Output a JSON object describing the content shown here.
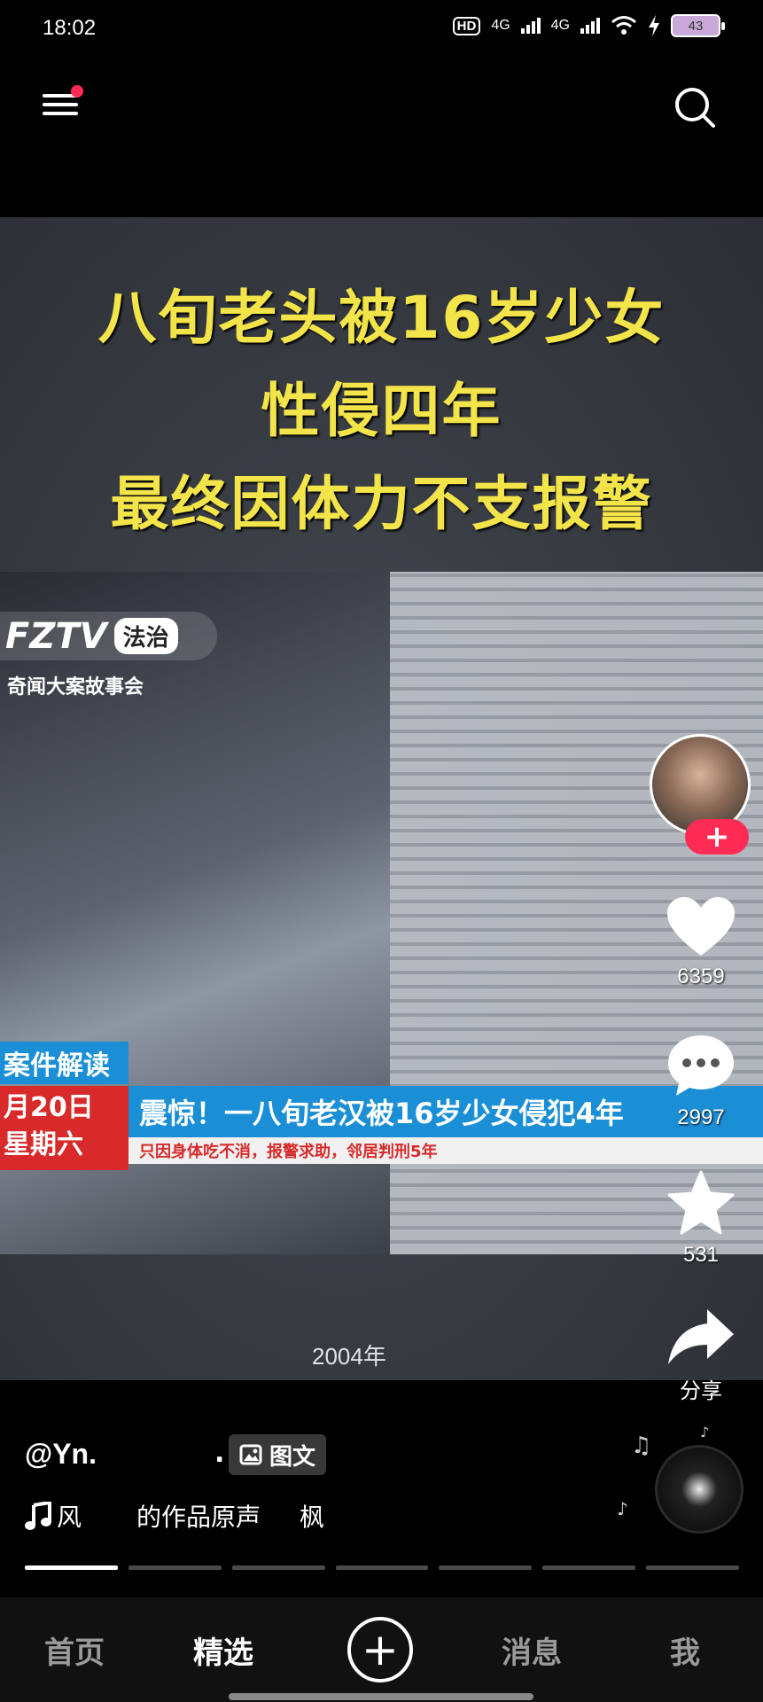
{
  "status_bar": {
    "time": "18:02",
    "hd": "HD",
    "network1": "4G",
    "network2": "4G",
    "battery": "43"
  },
  "video": {
    "caption_lines": [
      "八旬老头被16岁少女",
      "性侵四年",
      "最终因体力不支报警"
    ],
    "logo_main": "FZTV",
    "logo_tag": "法治",
    "logo_sub": "奇闻大案故事会",
    "year_label": "2004年",
    "lower_third": {
      "section": "案件解读",
      "date": "月20日",
      "weekday": "星期六",
      "headline": "震惊！一八旬老汉被16岁少女侵犯4年",
      "subline": "只因身体吃不消，报警求助，邻居判刑5年"
    }
  },
  "side_actions": {
    "follow": "+",
    "likes": "6359",
    "comments": "2997",
    "favorites": "531",
    "share": "分享"
  },
  "post": {
    "author": "@Yn.",
    "author_dot": ".",
    "type_badge": "图文",
    "music_a": "风",
    "music_b": "的作品原声",
    "music_c": "枫"
  },
  "progress": {
    "segments": 7,
    "active_index": 0
  },
  "bottom_nav": {
    "home": "首页",
    "picks": "精选",
    "add": "+",
    "messages": "消息",
    "me": "我"
  },
  "colors": {
    "accent": "#fe2c55",
    "caption": "#f3e44a",
    "news_blue": "#1b8fd6",
    "news_red": "#d82a2a"
  }
}
